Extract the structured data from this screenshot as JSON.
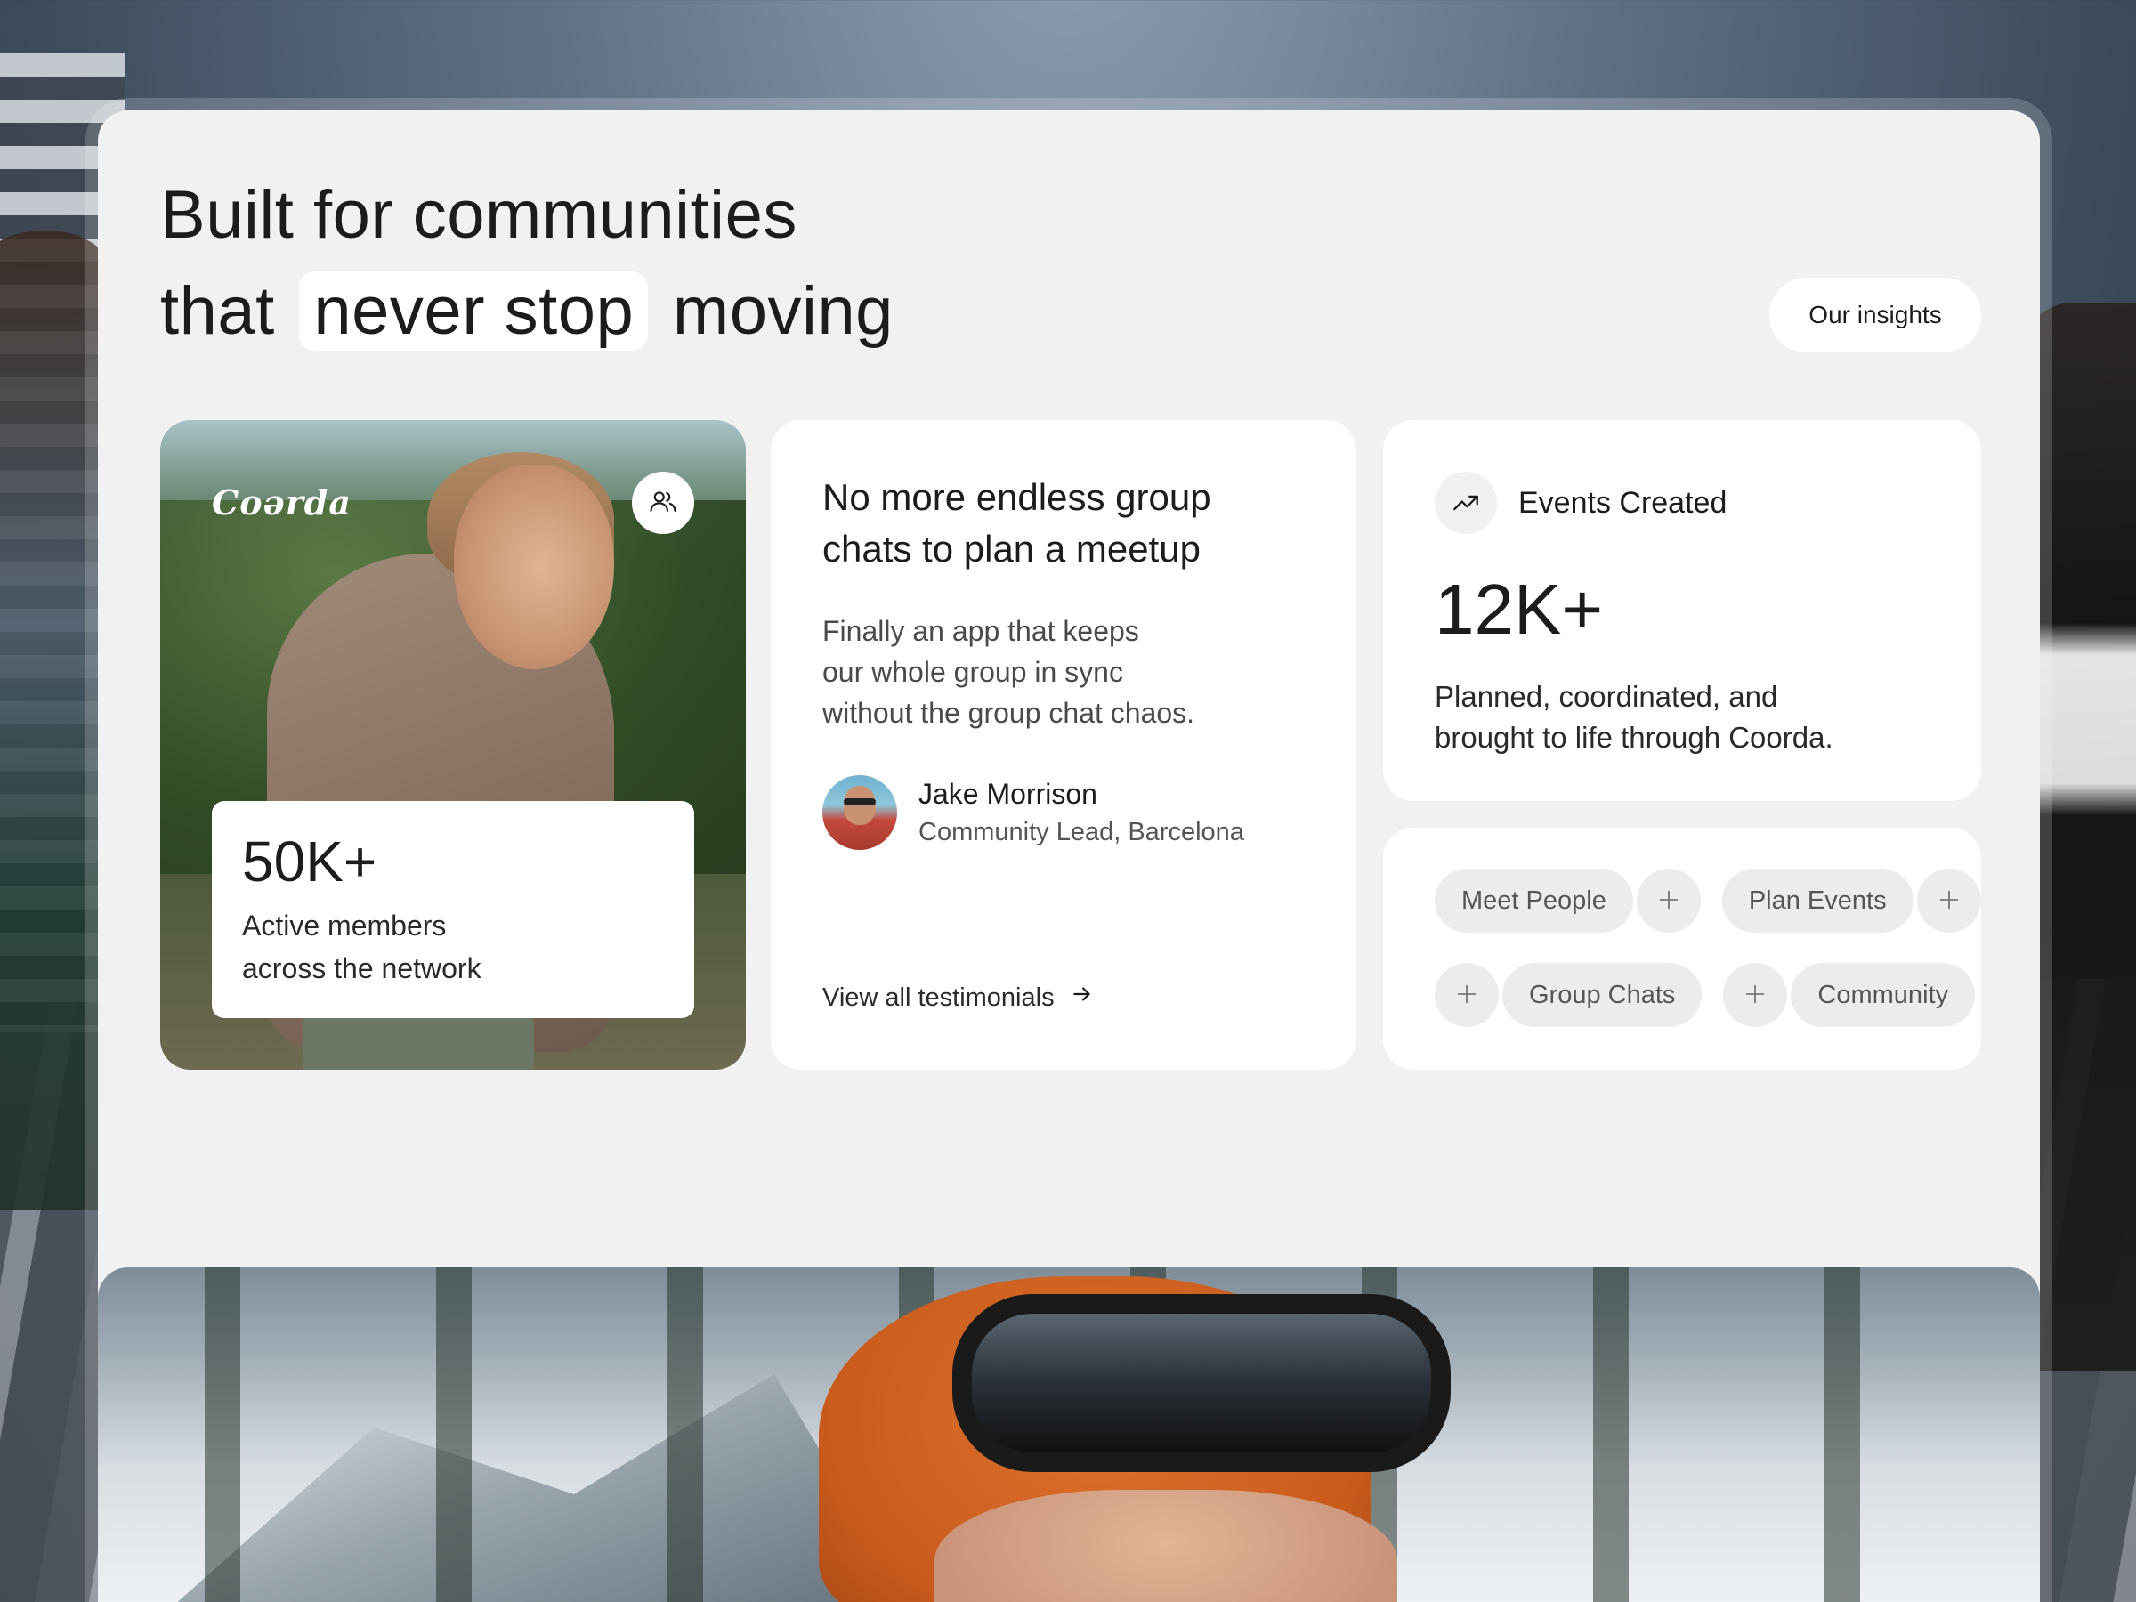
{
  "headline": {
    "line1": "Built for communities",
    "line2_before": "that",
    "line2_highlight": "never stop",
    "line2_after": "moving"
  },
  "insights_button": "Our insights",
  "photo_card": {
    "brand": "Coərda",
    "members_icon": "users-icon",
    "stat_value": "50K+",
    "stat_label": "Active members\nacross the network"
  },
  "testimonial": {
    "title": "No more endless group chats to plan a meetup",
    "quote": "Finally an app that keeps\nour whole group in sync\nwithout the group chat chaos.",
    "author_name": "Jake Morrison",
    "author_role": "Community Lead, Barcelona",
    "view_all": "View all testimonials",
    "arrow_icon": "arrow-right-icon"
  },
  "events": {
    "icon": "trending-up-icon",
    "label": "Events Created",
    "value": "12K+",
    "description": "Planned, coordinated, and\nbrought to life through Coorda."
  },
  "tags": {
    "row1": [
      "Meet People",
      "Plan Events"
    ],
    "row2": [
      "Group Chats",
      "Community"
    ]
  },
  "colors": {
    "panel": "#f1f1f1",
    "card": "#ffffff",
    "chip": "#ececec",
    "text": "#1c1c1c"
  }
}
